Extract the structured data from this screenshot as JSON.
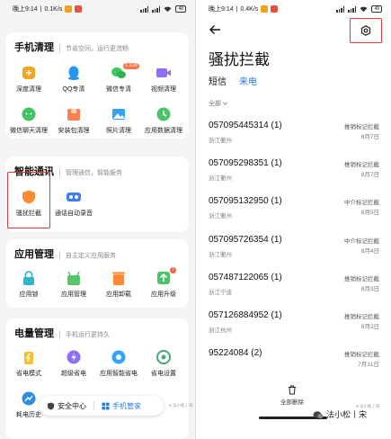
{
  "status_bar": {
    "left": {
      "time": "晚上9:14",
      "speed": "0.1K/s"
    },
    "right": {
      "time": "晚上9:14",
      "speed": "0.4K/s"
    },
    "battery": "48"
  },
  "left_screen": {
    "sections": [
      {
        "title": "手机清理",
        "subtitle": "节省空间，运行更流畅",
        "items": [
          {
            "label": "深度清理",
            "icon": "deep-clean-icon",
            "color": "#f5a623"
          },
          {
            "label": "QQ专清",
            "icon": "qq-icon",
            "color": "#2196f3"
          },
          {
            "label": "微信专清",
            "icon": "wechat-icon",
            "color": "#43c463",
            "badge": "1.1GB"
          },
          {
            "label": "视频清理",
            "icon": "video-icon",
            "color": "#8e6ff5"
          },
          {
            "label": "微信聊天清理",
            "icon": "wechat-chat-icon",
            "color": "#43c463"
          },
          {
            "label": "安装包清理",
            "icon": "package-icon",
            "color": "#ff7f50"
          },
          {
            "label": "照片清理",
            "icon": "photo-icon",
            "color": "#33a3f5"
          },
          {
            "label": "应用数据清理",
            "icon": "app-data-icon",
            "color": "#4cc36b"
          }
        ]
      },
      {
        "title": "智能通讯",
        "subtitle": "管理通信，智能服务",
        "items": [
          {
            "label": "骚扰拦截",
            "icon": "shield-icon",
            "color": "#ff8a33"
          },
          {
            "label": "通话自动录音",
            "icon": "call-record-icon",
            "color": "#3f7ff0"
          }
        ]
      },
      {
        "title": "应用管理",
        "subtitle": "自主定义应用服务",
        "items": [
          {
            "label": "应用锁",
            "icon": "app-lock-icon",
            "color": "#34b6c9"
          },
          {
            "label": "应用管理",
            "icon": "app-manage-icon",
            "color": "#5bc46a"
          },
          {
            "label": "应用卸载",
            "icon": "uninstall-icon",
            "color": "#ff8a33"
          },
          {
            "label": "应用升级",
            "icon": "upgrade-icon",
            "color": "#4cc36b",
            "badge": "1"
          }
        ]
      },
      {
        "title": "电量管理",
        "subtitle": "手机运行更持久",
        "items": [
          {
            "label": "省电模式",
            "icon": "battery-saver-icon",
            "color": "#f5c033"
          },
          {
            "label": "超级省电",
            "icon": "super-saver-icon",
            "color": "#8e6ff5"
          },
          {
            "label": "应用智能省电",
            "icon": "smart-saver-icon",
            "color": "#33a3f5"
          },
          {
            "label": "省电设置",
            "icon": "power-settings-icon",
            "color": "#4aa37a"
          },
          {
            "label": "耗电历史",
            "icon": "power-history-icon",
            "color": "#2f8de4"
          }
        ]
      }
    ],
    "bottom_bar": {
      "security": "安全中心",
      "manager": "手机管家"
    },
    "watermark_small": "● 法小松丨宋"
  },
  "right_screen": {
    "title": "骚扰拦截",
    "tabs": [
      {
        "label": "短信",
        "active": false
      },
      {
        "label": "来电",
        "active": true
      }
    ],
    "filter": "全部",
    "calls": [
      {
        "number": "057095445314 (1)",
        "location": "浙江衢州",
        "tag": "推销标记拦截",
        "date": "8月7日"
      },
      {
        "number": "057095298351 (1)",
        "location": "浙江衢州",
        "tag": "推销标记拦截",
        "date": "8月7日"
      },
      {
        "number": "057095132950 (1)",
        "location": "浙江衢州",
        "tag": "中介标记拦截",
        "date": "8月5日"
      },
      {
        "number": "057095726354 (1)",
        "location": "浙江衢州",
        "tag": "中介标记拦截",
        "date": "8月4日"
      },
      {
        "number": "057487122065 (1)",
        "location": "浙江宁波",
        "tag": "推销标记拦截",
        "date": "8月3日"
      },
      {
        "number": "057126884952 (1)",
        "location": "浙江杭州",
        "tag": "推销标记拦截",
        "date": "8月2日"
      },
      {
        "number": "95224084 (2)",
        "location": "",
        "tag": "推销标记拦截",
        "date": "7月31日"
      }
    ],
    "delete_all": "全部删除",
    "watermark": "法小松丨宋",
    "watermark_small": "● 法小松丨宋"
  },
  "colors": {
    "accent_blue": "#2a7be4",
    "highlight_red": "#e53935"
  }
}
